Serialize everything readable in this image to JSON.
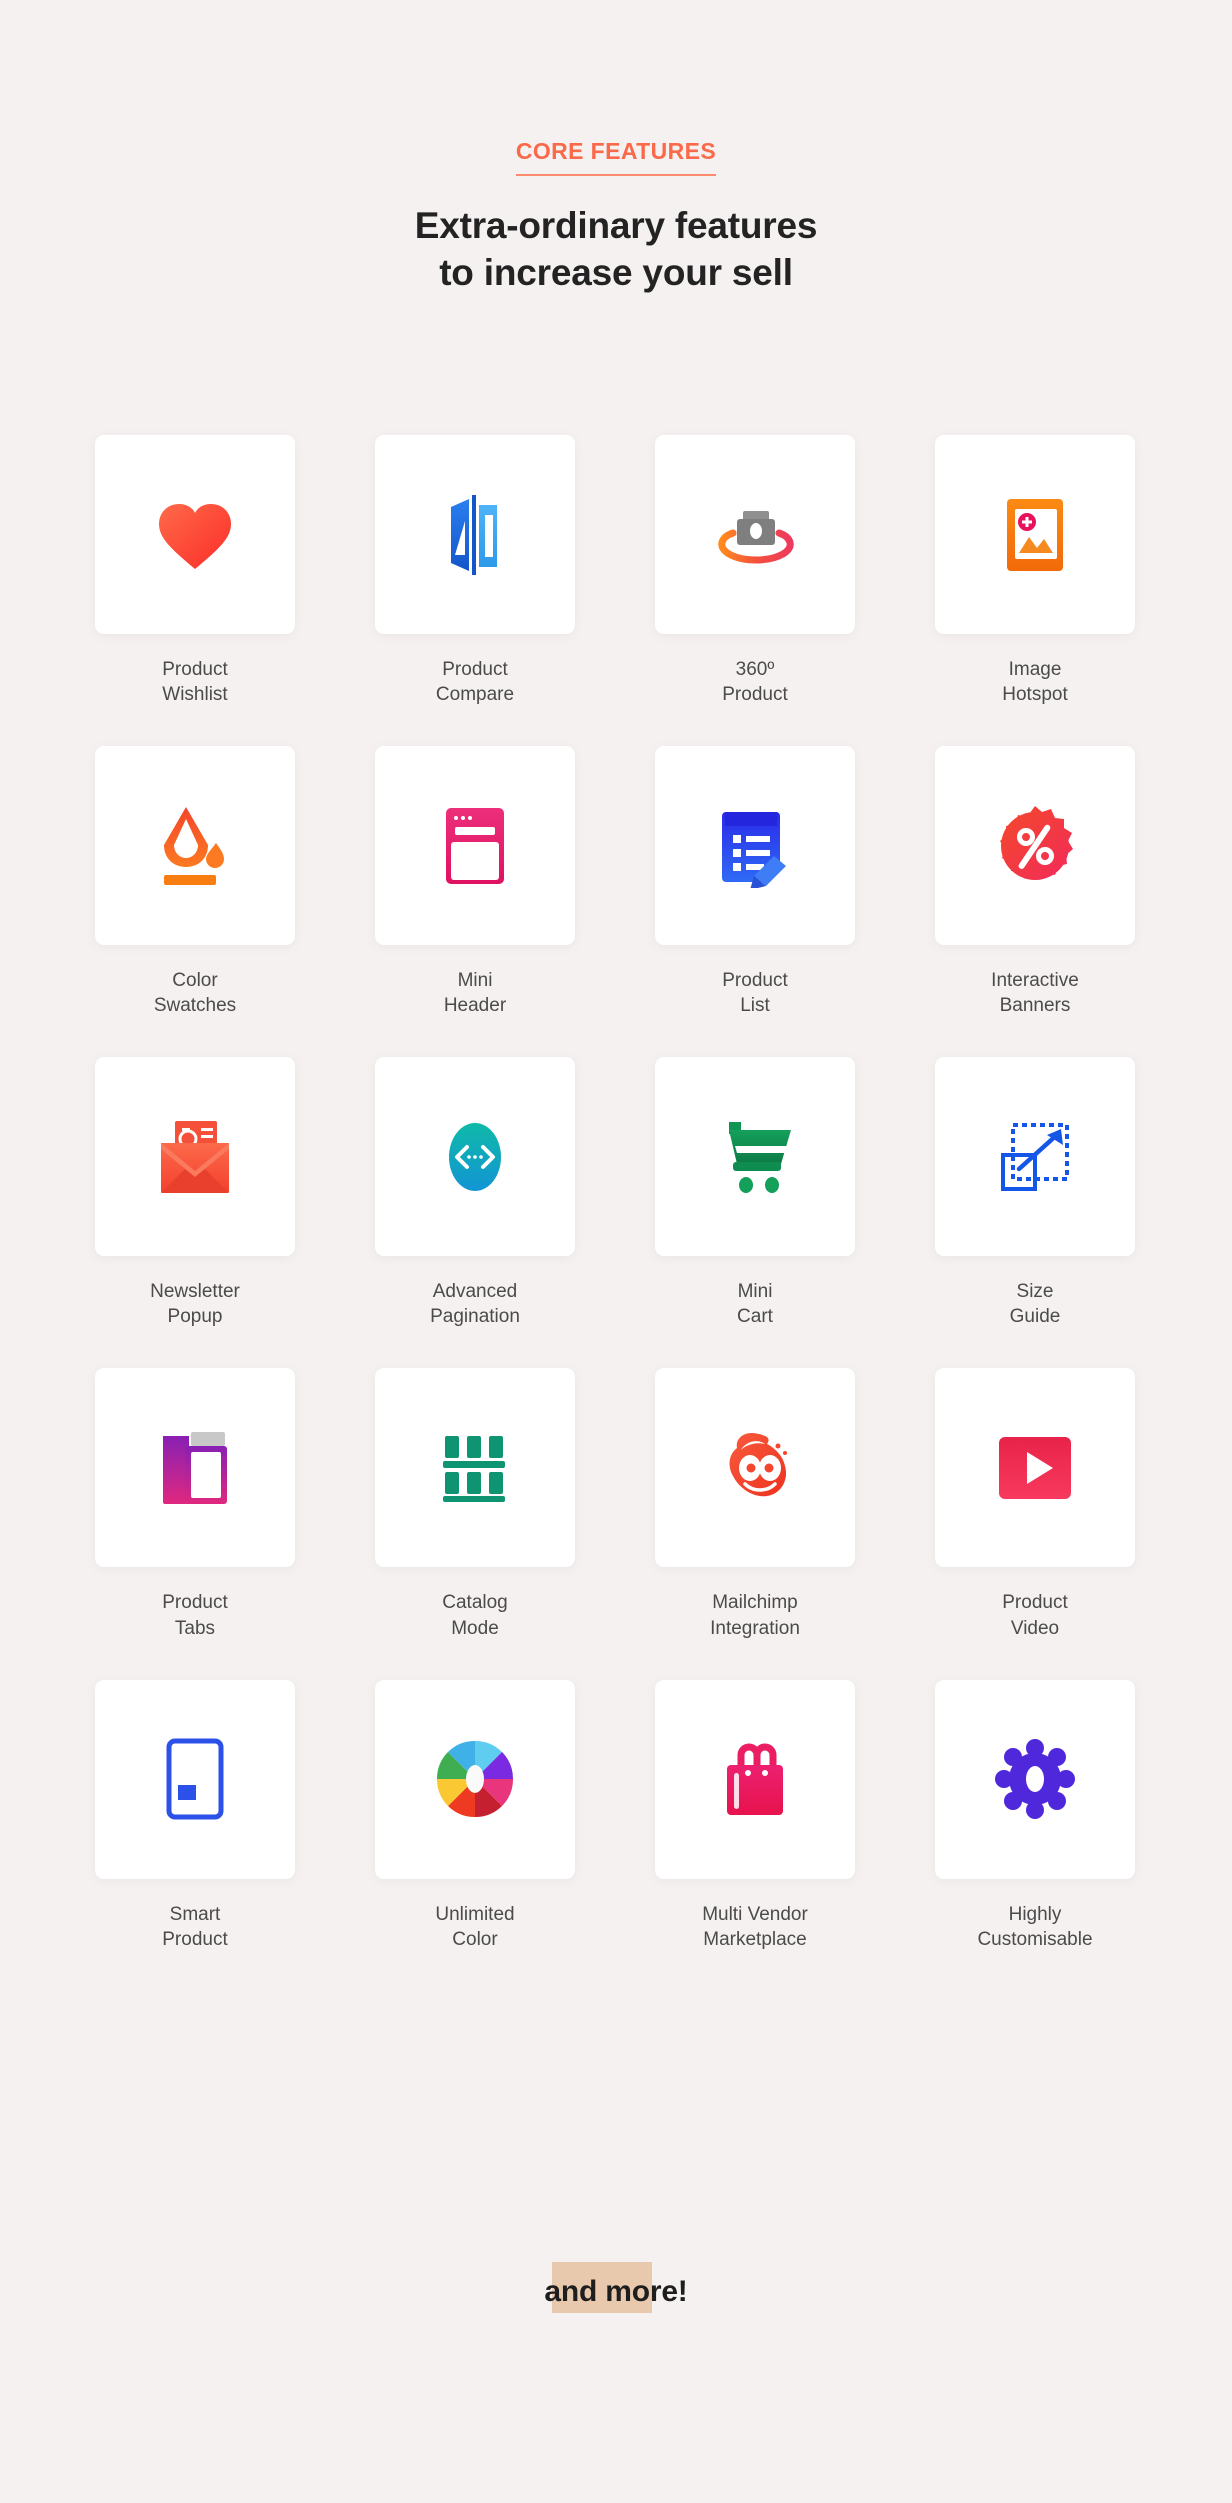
{
  "header": {
    "eyebrow": "CORE FEATURES",
    "headline_line1": "Extra-ordinary features",
    "headline_line2": "to increase your sell",
    "eyebrow_color": "#fa6a4a",
    "headline_color": "#232323"
  },
  "page": {
    "background_color": "#f5f1f0",
    "card_background": "#ffffff",
    "label_color": "#4b4b4b"
  },
  "features": [
    {
      "icon": "heart-icon",
      "label": "Product\nWishlist",
      "color": "#fb4a3c"
    },
    {
      "icon": "compare-icon",
      "label": "Product\nCompare",
      "color": "#1b6fe0"
    },
    {
      "icon": "camera-360-icon",
      "label": "360º\nProduct",
      "color": "#7d7d7d"
    },
    {
      "icon": "image-hotspot-icon",
      "label": "Image\nHotspot",
      "color": "#f47b12"
    },
    {
      "icon": "paint-bucket-icon",
      "label": "Color\nSwatches",
      "color": "#f4511e"
    },
    {
      "icon": "browser-window-icon",
      "label": "Mini\nHeader",
      "color": "#e6266b"
    },
    {
      "icon": "list-edit-icon",
      "label": "Product\nList",
      "color": "#2b3fe0"
    },
    {
      "icon": "percent-badge-icon",
      "label": "Interactive\nBanners",
      "color": "#f4394a"
    },
    {
      "icon": "email-at-icon",
      "label": "Newsletter\nPopup",
      "color": "#fa5a4a"
    },
    {
      "icon": "pagination-code-icon",
      "label": "Advanced\nPagination",
      "color": "#0fb5b0"
    },
    {
      "icon": "shopping-cart-icon",
      "label": "Mini\nCart",
      "color": "#129c53"
    },
    {
      "icon": "size-guide-icon",
      "label": "Size\nGuide",
      "color": "#1457e8"
    },
    {
      "icon": "folder-tabs-icon",
      "label": "Product\nTabs",
      "color": "#c0228e"
    },
    {
      "icon": "catalog-grid-icon",
      "label": "Catalog\nMode",
      "color": "#0f9471"
    },
    {
      "icon": "mailchimp-icon",
      "label": "Mailchimp\nIntegration",
      "color": "#f4452e"
    },
    {
      "icon": "play-video-icon",
      "label": "Product\nVideo",
      "color": "#f32347"
    },
    {
      "icon": "smart-phone-icon",
      "label": "Smart\nProduct",
      "color": "#2c51e8"
    },
    {
      "icon": "color-wheel-icon",
      "label": "Unlimited\nColor",
      "color": "#e83b4a"
    },
    {
      "icon": "shopping-bag-icon",
      "label": "Multi Vendor\nMarketplace",
      "color": "#ec1e63"
    },
    {
      "icon": "gear-icon",
      "label": "Highly\nCustomisable",
      "color": "#5028dc"
    }
  ],
  "footer": {
    "more_label": "and more!",
    "highlight_color": "#e9c9ad"
  }
}
